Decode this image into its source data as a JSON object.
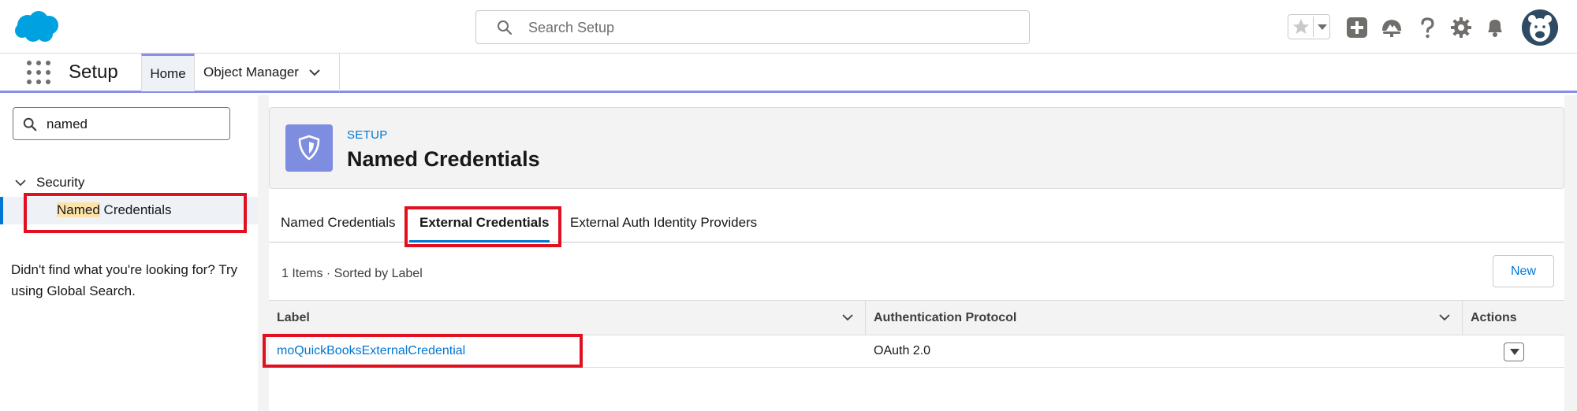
{
  "header": {
    "search_placeholder": "Search Setup"
  },
  "app_nav": {
    "app_name": "Setup",
    "tabs": [
      {
        "label": "Home"
      },
      {
        "label": "Object Manager"
      }
    ]
  },
  "sidebar": {
    "quick_find_value": "named",
    "tree_parent": "Security",
    "tree_child": {
      "highlight": "Named",
      "rest": " Credentials"
    },
    "not_found_text": "Didn't find what you're looking for? Try using Global Search."
  },
  "page_header": {
    "eyebrow": "SETUP",
    "title": "Named Credentials"
  },
  "tabs": [
    {
      "label": "Named Credentials"
    },
    {
      "label": "External Credentials"
    },
    {
      "label": "External Auth Identity Providers"
    }
  ],
  "list": {
    "meta": "1 Items · Sorted by Label",
    "new_button": "New",
    "columns": [
      "Label",
      "Authentication Protocol",
      "Actions"
    ],
    "rows": [
      {
        "label": "moQuickBooksExternalCredential",
        "auth_protocol": "OAuth 2.0"
      }
    ]
  },
  "colors": {
    "brand": "#0176d3",
    "nav_accent": "#8a8fe5",
    "annotation_red": "#e0101f",
    "header_icon": "#7f8de1"
  },
  "icons": [
    "salesforce-cloud-icon",
    "search-icon",
    "star-icon",
    "chevron-down-icon",
    "add-icon",
    "trailhead-icon",
    "help-icon",
    "gear-icon",
    "bell-icon",
    "avatar-icon",
    "waffle-icon",
    "shield-icon"
  ]
}
